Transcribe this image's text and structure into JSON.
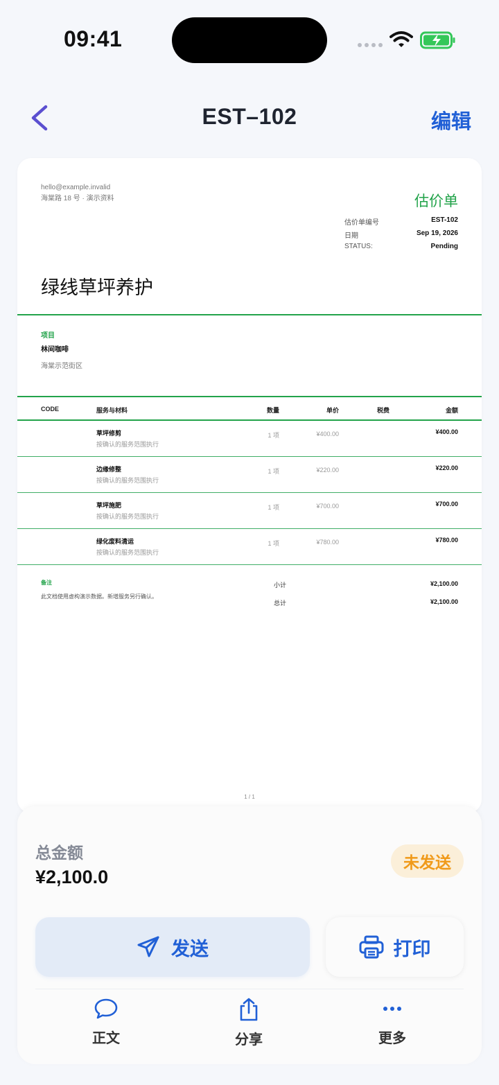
{
  "status_bar": {
    "time": "09:41"
  },
  "nav": {
    "title": "EST–102",
    "edit_label": "编辑"
  },
  "document": {
    "sender_email": "hello@example.invalid",
    "sender_address": "海棠路 18 号 · 演示资料",
    "doc_type": "估价单",
    "meta": [
      {
        "label": "估价单编号",
        "value": "EST-102"
      },
      {
        "label": "日期",
        "value": "Sep 19, 2026"
      },
      {
        "label": "STATUS:",
        "value": "Pending"
      }
    ],
    "company_name": "绿线草坪养护",
    "project_label": "项目",
    "project_name": "林间咖啡",
    "project_address": "海棠示范街区",
    "table_headers": {
      "code": "CODE",
      "service": "服务与材料",
      "qty": "数量",
      "unit_price": "单价",
      "tax": "税费",
      "amount": "金额"
    },
    "items": [
      {
        "name": "草坪修剪",
        "desc": "按确认的服务范围执行",
        "qty": "1 项",
        "price": "¥400.00",
        "amount": "¥400.00"
      },
      {
        "name": "边缘修整",
        "desc": "按确认的服务范围执行",
        "qty": "1 项",
        "price": "¥220.00",
        "amount": "¥220.00"
      },
      {
        "name": "草坪施肥",
        "desc": "按确认的服务范围执行",
        "qty": "1 项",
        "price": "¥700.00",
        "amount": "¥700.00"
      },
      {
        "name": "绿化废料清运",
        "desc": "按确认的服务范围执行",
        "qty": "1 项",
        "price": "¥780.00",
        "amount": "¥780.00"
      }
    ],
    "notes_label": "备注",
    "notes_text": "此文档使用虚构演示数据。新增服务另行确认。",
    "subtotal_label": "小计",
    "subtotal_value": "¥2,100.00",
    "total_label": "总计",
    "total_value": "¥2,100.00",
    "page_number": "1 / 1"
  },
  "panel": {
    "total_label": "总金额",
    "total_value": "¥2,100.0",
    "status_badge": "未发送",
    "send_label": "发送",
    "print_label": "打印",
    "tabs": [
      {
        "label": "正文",
        "icon": "chat-bubble-icon"
      },
      {
        "label": "分享",
        "icon": "share-icon"
      },
      {
        "label": "更多",
        "icon": "more-icon"
      }
    ]
  },
  "colors": {
    "accent_blue": "#2160d6",
    "green": "#22a34a",
    "badge_orange": "#f09a1a"
  }
}
